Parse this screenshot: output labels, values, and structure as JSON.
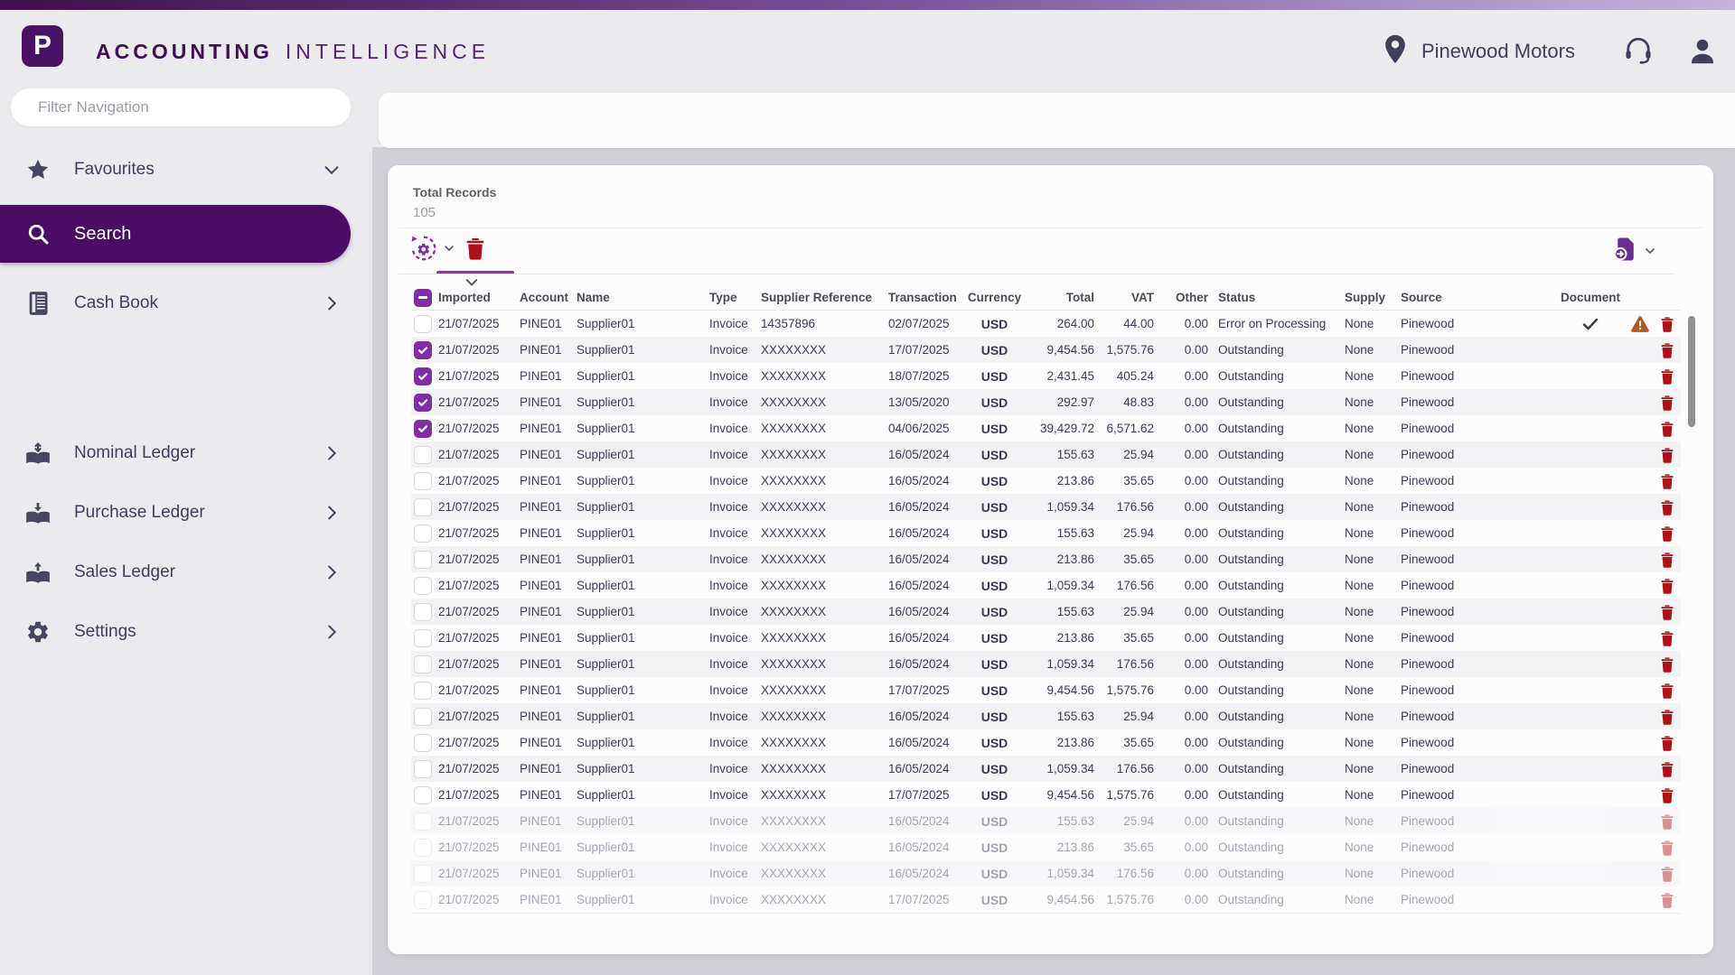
{
  "header": {
    "logo_letter": "P",
    "title_bold": "ACCOUNTING",
    "title_light": "INTELLIGENCE",
    "company": "Pinewood Motors"
  },
  "sidebar": {
    "filter_placeholder": "Filter Navigation",
    "items": [
      {
        "label": "Favourites",
        "icon": "star-icon",
        "chevron": "down",
        "active": false
      },
      {
        "label": "Search",
        "icon": "search-icon",
        "chevron": "none",
        "active": true
      },
      {
        "label": "Cash Book",
        "icon": "cash-book-icon",
        "chevron": "right",
        "active": false
      },
      {
        "label": "Nominal Ledger",
        "icon": "nominal-ledger-icon",
        "chevron": "right",
        "active": false
      },
      {
        "label": "Purchase Ledger",
        "icon": "purchase-ledger-icon",
        "chevron": "right",
        "active": false
      },
      {
        "label": "Sales Ledger",
        "icon": "sales-ledger-icon",
        "chevron": "right",
        "active": false
      },
      {
        "label": "Settings",
        "icon": "settings-icon",
        "chevron": "right",
        "active": false
      }
    ]
  },
  "content": {
    "total_records_label": "Total Records",
    "total_records_value": "105",
    "toolbar": {
      "process_icon": "sync-settings-icon",
      "delete_icon": "trash-icon",
      "export_icon": "export-document-icon"
    },
    "table": {
      "columns": [
        "Imported",
        "Account",
        "Name",
        "Type",
        "Supplier Reference",
        "Transaction",
        "Currency",
        "Total",
        "VAT",
        "Other",
        "Status",
        "Supply",
        "Source",
        "Document"
      ],
      "header_checkbox_state": "indeterminate",
      "rows": [
        {
          "checked": false,
          "imported": "21/07/2025",
          "account": "PINE01",
          "name": "Supplier01",
          "type": "Invoice",
          "supplier_reference": "14357896",
          "transaction": "02/07/2025",
          "currency": "USD",
          "total": "264.00",
          "vat": "44.00",
          "other": "0.00",
          "status": "Error on Processing",
          "supply": "None",
          "source": "Pinewood",
          "has_document": true,
          "has_warning": true,
          "faded": false
        },
        {
          "checked": true,
          "imported": "21/07/2025",
          "account": "PINE01",
          "name": "Supplier01",
          "type": "Invoice",
          "supplier_reference": "XXXXXXXX",
          "transaction": "17/07/2025",
          "currency": "USD",
          "total": "9,454.56",
          "vat": "1,575.76",
          "other": "0.00",
          "status": "Outstanding",
          "supply": "None",
          "source": "Pinewood",
          "has_document": false,
          "has_warning": false,
          "faded": false
        },
        {
          "checked": true,
          "imported": "21/07/2025",
          "account": "PINE01",
          "name": "Supplier01",
          "type": "Invoice",
          "supplier_reference": "XXXXXXXX",
          "transaction": "18/07/2025",
          "currency": "USD",
          "total": "2,431.45",
          "vat": "405.24",
          "other": "0.00",
          "status": "Outstanding",
          "supply": "None",
          "source": "Pinewood",
          "has_document": false,
          "has_warning": false,
          "faded": false
        },
        {
          "checked": true,
          "imported": "21/07/2025",
          "account": "PINE01",
          "name": "Supplier01",
          "type": "Invoice",
          "supplier_reference": "XXXXXXXX",
          "transaction": "13/05/2020",
          "currency": "USD",
          "total": "292.97",
          "vat": "48.83",
          "other": "0.00",
          "status": "Outstanding",
          "supply": "None",
          "source": "Pinewood",
          "has_document": false,
          "has_warning": false,
          "faded": false
        },
        {
          "checked": true,
          "imported": "21/07/2025",
          "account": "PINE01",
          "name": "Supplier01",
          "type": "Invoice",
          "supplier_reference": "XXXXXXXX",
          "transaction": "04/06/2025",
          "currency": "USD",
          "total": "39,429.72",
          "vat": "6,571.62",
          "other": "0.00",
          "status": "Outstanding",
          "supply": "None",
          "source": "Pinewood",
          "has_document": false,
          "has_warning": false,
          "faded": false
        },
        {
          "checked": false,
          "imported": "21/07/2025",
          "account": "PINE01",
          "name": "Supplier01",
          "type": "Invoice",
          "supplier_reference": "XXXXXXXX",
          "transaction": "16/05/2024",
          "currency": "USD",
          "total": "155.63",
          "vat": "25.94",
          "other": "0.00",
          "status": "Outstanding",
          "supply": "None",
          "source": "Pinewood",
          "has_document": false,
          "has_warning": false,
          "faded": false
        },
        {
          "checked": false,
          "imported": "21/07/2025",
          "account": "PINE01",
          "name": "Supplier01",
          "type": "Invoice",
          "supplier_reference": "XXXXXXXX",
          "transaction": "16/05/2024",
          "currency": "USD",
          "total": "213.86",
          "vat": "35.65",
          "other": "0.00",
          "status": "Outstanding",
          "supply": "None",
          "source": "Pinewood",
          "has_document": false,
          "has_warning": false,
          "faded": false
        },
        {
          "checked": false,
          "imported": "21/07/2025",
          "account": "PINE01",
          "name": "Supplier01",
          "type": "Invoice",
          "supplier_reference": "XXXXXXXX",
          "transaction": "16/05/2024",
          "currency": "USD",
          "total": "1,059.34",
          "vat": "176.56",
          "other": "0.00",
          "status": "Outstanding",
          "supply": "None",
          "source": "Pinewood",
          "has_document": false,
          "has_warning": false,
          "faded": false
        },
        {
          "checked": false,
          "imported": "21/07/2025",
          "account": "PINE01",
          "name": "Supplier01",
          "type": "Invoice",
          "supplier_reference": "XXXXXXXX",
          "transaction": "16/05/2024",
          "currency": "USD",
          "total": "155.63",
          "vat": "25.94",
          "other": "0.00",
          "status": "Outstanding",
          "supply": "None",
          "source": "Pinewood",
          "has_document": false,
          "has_warning": false,
          "faded": false
        },
        {
          "checked": false,
          "imported": "21/07/2025",
          "account": "PINE01",
          "name": "Supplier01",
          "type": "Invoice",
          "supplier_reference": "XXXXXXXX",
          "transaction": "16/05/2024",
          "currency": "USD",
          "total": "213.86",
          "vat": "35.65",
          "other": "0.00",
          "status": "Outstanding",
          "supply": "None",
          "source": "Pinewood",
          "has_document": false,
          "has_warning": false,
          "faded": false
        },
        {
          "checked": false,
          "imported": "21/07/2025",
          "account": "PINE01",
          "name": "Supplier01",
          "type": "Invoice",
          "supplier_reference": "XXXXXXXX",
          "transaction": "16/05/2024",
          "currency": "USD",
          "total": "1,059.34",
          "vat": "176.56",
          "other": "0.00",
          "status": "Outstanding",
          "supply": "None",
          "source": "Pinewood",
          "has_document": false,
          "has_warning": false,
          "faded": false
        },
        {
          "checked": false,
          "imported": "21/07/2025",
          "account": "PINE01",
          "name": "Supplier01",
          "type": "Invoice",
          "supplier_reference": "XXXXXXXX",
          "transaction": "16/05/2024",
          "currency": "USD",
          "total": "155.63",
          "vat": "25.94",
          "other": "0.00",
          "status": "Outstanding",
          "supply": "None",
          "source": "Pinewood",
          "has_document": false,
          "has_warning": false,
          "faded": false
        },
        {
          "checked": false,
          "imported": "21/07/2025",
          "account": "PINE01",
          "name": "Supplier01",
          "type": "Invoice",
          "supplier_reference": "XXXXXXXX",
          "transaction": "16/05/2024",
          "currency": "USD",
          "total": "213.86",
          "vat": "35.65",
          "other": "0.00",
          "status": "Outstanding",
          "supply": "None",
          "source": "Pinewood",
          "has_document": false,
          "has_warning": false,
          "faded": false
        },
        {
          "checked": false,
          "imported": "21/07/2025",
          "account": "PINE01",
          "name": "Supplier01",
          "type": "Invoice",
          "supplier_reference": "XXXXXXXX",
          "transaction": "16/05/2024",
          "currency": "USD",
          "total": "1,059.34",
          "vat": "176.56",
          "other": "0.00",
          "status": "Outstanding",
          "supply": "None",
          "source": "Pinewood",
          "has_document": false,
          "has_warning": false,
          "faded": false
        },
        {
          "checked": false,
          "imported": "21/07/2025",
          "account": "PINE01",
          "name": "Supplier01",
          "type": "Invoice",
          "supplier_reference": "XXXXXXXX",
          "transaction": "17/07/2025",
          "currency": "USD",
          "total": "9,454.56",
          "vat": "1,575.76",
          "other": "0.00",
          "status": "Outstanding",
          "supply": "None",
          "source": "Pinewood",
          "has_document": false,
          "has_warning": false,
          "faded": false
        },
        {
          "checked": false,
          "imported": "21/07/2025",
          "account": "PINE01",
          "name": "Supplier01",
          "type": "Invoice",
          "supplier_reference": "XXXXXXXX",
          "transaction": "16/05/2024",
          "currency": "USD",
          "total": "155.63",
          "vat": "25.94",
          "other": "0.00",
          "status": "Outstanding",
          "supply": "None",
          "source": "Pinewood",
          "has_document": false,
          "has_warning": false,
          "faded": false
        },
        {
          "checked": false,
          "imported": "21/07/2025",
          "account": "PINE01",
          "name": "Supplier01",
          "type": "Invoice",
          "supplier_reference": "XXXXXXXX",
          "transaction": "16/05/2024",
          "currency": "USD",
          "total": "213.86",
          "vat": "35.65",
          "other": "0.00",
          "status": "Outstanding",
          "supply": "None",
          "source": "Pinewood",
          "has_document": false,
          "has_warning": false,
          "faded": false
        },
        {
          "checked": false,
          "imported": "21/07/2025",
          "account": "PINE01",
          "name": "Supplier01",
          "type": "Invoice",
          "supplier_reference": "XXXXXXXX",
          "transaction": "16/05/2024",
          "currency": "USD",
          "total": "1,059.34",
          "vat": "176.56",
          "other": "0.00",
          "status": "Outstanding",
          "supply": "None",
          "source": "Pinewood",
          "has_document": false,
          "has_warning": false,
          "faded": false
        },
        {
          "checked": false,
          "imported": "21/07/2025",
          "account": "PINE01",
          "name": "Supplier01",
          "type": "Invoice",
          "supplier_reference": "XXXXXXXX",
          "transaction": "17/07/2025",
          "currency": "USD",
          "total": "9,454.56",
          "vat": "1,575.76",
          "other": "0.00",
          "status": "Outstanding",
          "supply": "None",
          "source": "Pinewood",
          "has_document": false,
          "has_warning": false,
          "faded": false
        },
        {
          "checked": false,
          "imported": "21/07/2025",
          "account": "PINE01",
          "name": "Supplier01",
          "type": "Invoice",
          "supplier_reference": "XXXXXXXX",
          "transaction": "16/05/2024",
          "currency": "USD",
          "total": "155.63",
          "vat": "25.94",
          "other": "0.00",
          "status": "Outstanding",
          "supply": "None",
          "source": "Pinewood",
          "has_document": false,
          "has_warning": false,
          "faded": true
        },
        {
          "checked": false,
          "imported": "21/07/2025",
          "account": "PINE01",
          "name": "Supplier01",
          "type": "Invoice",
          "supplier_reference": "XXXXXXXX",
          "transaction": "16/05/2024",
          "currency": "USD",
          "total": "213.86",
          "vat": "35.65",
          "other": "0.00",
          "status": "Outstanding",
          "supply": "None",
          "source": "Pinewood",
          "has_document": false,
          "has_warning": false,
          "faded": true
        },
        {
          "checked": false,
          "imported": "21/07/2025",
          "account": "PINE01",
          "name": "Supplier01",
          "type": "Invoice",
          "supplier_reference": "XXXXXXXX",
          "transaction": "16/05/2024",
          "currency": "USD",
          "total": "1,059.34",
          "vat": "176.56",
          "other": "0.00",
          "status": "Outstanding",
          "supply": "None",
          "source": "Pinewood",
          "has_document": false,
          "has_warning": false,
          "faded": true
        },
        {
          "checked": false,
          "imported": "21/07/2025",
          "account": "PINE01",
          "name": "Supplier01",
          "type": "Invoice",
          "supplier_reference": "XXXXXXXX",
          "transaction": "17/07/2025",
          "currency": "USD",
          "total": "9,454.56",
          "vat": "1,575.76",
          "other": "0.00",
          "status": "Outstanding",
          "supply": "None",
          "source": "Pinewood",
          "has_document": false,
          "has_warning": false,
          "faded": true
        }
      ]
    }
  },
  "colors": {
    "brand_dark_purple": "#4a0d63",
    "accent_purple": "#7d2ea8",
    "delete_red": "#b01117",
    "warning_orange": "#b05c20",
    "page_gray": "#d1d0d6",
    "panel_gray": "#ebebee",
    "alt_row": "#f3f3f6"
  }
}
